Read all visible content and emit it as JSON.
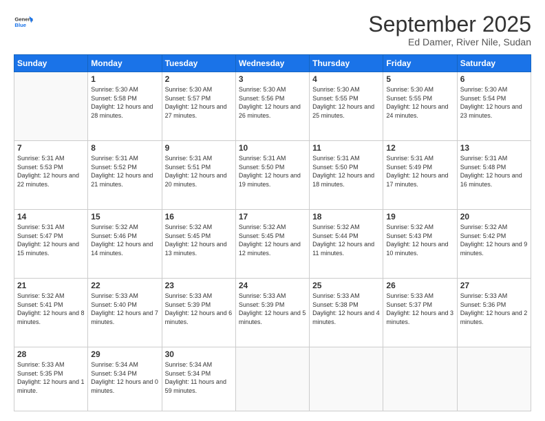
{
  "header": {
    "logo_general": "General",
    "logo_blue": "Blue",
    "month_title": "September 2025",
    "location": "Ed Damer, River Nile, Sudan"
  },
  "weekdays": [
    "Sunday",
    "Monday",
    "Tuesday",
    "Wednesday",
    "Thursday",
    "Friday",
    "Saturday"
  ],
  "weeks": [
    [
      {
        "day": null
      },
      {
        "day": "1",
        "sunrise": "5:30 AM",
        "sunset": "5:58 PM",
        "daylight": "12 hours and 28 minutes."
      },
      {
        "day": "2",
        "sunrise": "5:30 AM",
        "sunset": "5:57 PM",
        "daylight": "12 hours and 27 minutes."
      },
      {
        "day": "3",
        "sunrise": "5:30 AM",
        "sunset": "5:56 PM",
        "daylight": "12 hours and 26 minutes."
      },
      {
        "day": "4",
        "sunrise": "5:30 AM",
        "sunset": "5:55 PM",
        "daylight": "12 hours and 25 minutes."
      },
      {
        "day": "5",
        "sunrise": "5:30 AM",
        "sunset": "5:55 PM",
        "daylight": "12 hours and 24 minutes."
      },
      {
        "day": "6",
        "sunrise": "5:30 AM",
        "sunset": "5:54 PM",
        "daylight": "12 hours and 23 minutes."
      }
    ],
    [
      {
        "day": "7",
        "sunrise": "5:31 AM",
        "sunset": "5:53 PM",
        "daylight": "12 hours and 22 minutes."
      },
      {
        "day": "8",
        "sunrise": "5:31 AM",
        "sunset": "5:52 PM",
        "daylight": "12 hours and 21 minutes."
      },
      {
        "day": "9",
        "sunrise": "5:31 AM",
        "sunset": "5:51 PM",
        "daylight": "12 hours and 20 minutes."
      },
      {
        "day": "10",
        "sunrise": "5:31 AM",
        "sunset": "5:50 PM",
        "daylight": "12 hours and 19 minutes."
      },
      {
        "day": "11",
        "sunrise": "5:31 AM",
        "sunset": "5:50 PM",
        "daylight": "12 hours and 18 minutes."
      },
      {
        "day": "12",
        "sunrise": "5:31 AM",
        "sunset": "5:49 PM",
        "daylight": "12 hours and 17 minutes."
      },
      {
        "day": "13",
        "sunrise": "5:31 AM",
        "sunset": "5:48 PM",
        "daylight": "12 hours and 16 minutes."
      }
    ],
    [
      {
        "day": "14",
        "sunrise": "5:31 AM",
        "sunset": "5:47 PM",
        "daylight": "12 hours and 15 minutes."
      },
      {
        "day": "15",
        "sunrise": "5:32 AM",
        "sunset": "5:46 PM",
        "daylight": "12 hours and 14 minutes."
      },
      {
        "day": "16",
        "sunrise": "5:32 AM",
        "sunset": "5:45 PM",
        "daylight": "12 hours and 13 minutes."
      },
      {
        "day": "17",
        "sunrise": "5:32 AM",
        "sunset": "5:45 PM",
        "daylight": "12 hours and 12 minutes."
      },
      {
        "day": "18",
        "sunrise": "5:32 AM",
        "sunset": "5:44 PM",
        "daylight": "12 hours and 11 minutes."
      },
      {
        "day": "19",
        "sunrise": "5:32 AM",
        "sunset": "5:43 PM",
        "daylight": "12 hours and 10 minutes."
      },
      {
        "day": "20",
        "sunrise": "5:32 AM",
        "sunset": "5:42 PM",
        "daylight": "12 hours and 9 minutes."
      }
    ],
    [
      {
        "day": "21",
        "sunrise": "5:32 AM",
        "sunset": "5:41 PM",
        "daylight": "12 hours and 8 minutes."
      },
      {
        "day": "22",
        "sunrise": "5:33 AM",
        "sunset": "5:40 PM",
        "daylight": "12 hours and 7 minutes."
      },
      {
        "day": "23",
        "sunrise": "5:33 AM",
        "sunset": "5:39 PM",
        "daylight": "12 hours and 6 minutes."
      },
      {
        "day": "24",
        "sunrise": "5:33 AM",
        "sunset": "5:39 PM",
        "daylight": "12 hours and 5 minutes."
      },
      {
        "day": "25",
        "sunrise": "5:33 AM",
        "sunset": "5:38 PM",
        "daylight": "12 hours and 4 minutes."
      },
      {
        "day": "26",
        "sunrise": "5:33 AM",
        "sunset": "5:37 PM",
        "daylight": "12 hours and 3 minutes."
      },
      {
        "day": "27",
        "sunrise": "5:33 AM",
        "sunset": "5:36 PM",
        "daylight": "12 hours and 2 minutes."
      }
    ],
    [
      {
        "day": "28",
        "sunrise": "5:33 AM",
        "sunset": "5:35 PM",
        "daylight": "12 hours and 1 minute."
      },
      {
        "day": "29",
        "sunrise": "5:34 AM",
        "sunset": "5:34 PM",
        "daylight": "12 hours and 0 minutes."
      },
      {
        "day": "30",
        "sunrise": "5:34 AM",
        "sunset": "5:34 PM",
        "daylight": "11 hours and 59 minutes."
      },
      {
        "day": null
      },
      {
        "day": null
      },
      {
        "day": null
      },
      {
        "day": null
      }
    ]
  ]
}
